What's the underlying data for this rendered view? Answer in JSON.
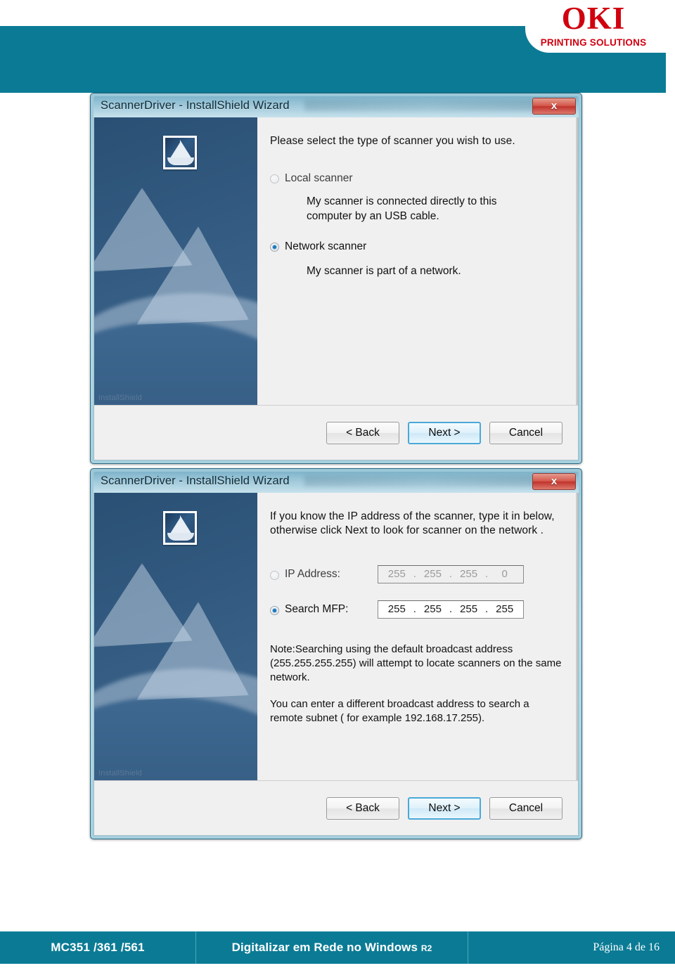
{
  "header": {
    "logo_word": "OKI",
    "logo_tagline": "PRINTING SOLUTIONS",
    "brand_color": "#d1000f",
    "band_color": "#0b7b95"
  },
  "dialog1": {
    "title": "ScannerDriver - InstallShield Wizard",
    "close_label": "x",
    "side_panel_text": "InstallShield",
    "prompt": "Please select the type of scanner you wish to use.",
    "options": [
      {
        "label": "Local scanner",
        "selected": false,
        "description": "My scanner is connected directly to this computer by an USB cable."
      },
      {
        "label": "Network scanner",
        "selected": true,
        "description": "My scanner is part of a network."
      }
    ],
    "buttons": {
      "back": "< Back",
      "back_prefix": "< ",
      "back_accel": "B",
      "back_rest": "ack",
      "next": "Next >",
      "cancel": "Cancel"
    }
  },
  "dialog2": {
    "title": "ScannerDriver - InstallShield Wizard",
    "close_label": "x",
    "side_panel_text": "InstallShield",
    "prompt": "If you know the IP address of the scanner, type it in below, otherwise click Next to look for scanner on the network .",
    "ip_address": {
      "label": "IP Address:",
      "selected": false,
      "enabled": false,
      "octets": [
        "255",
        "255",
        "255",
        "0"
      ]
    },
    "search_mfp": {
      "label": "Search MFP:",
      "selected": true,
      "enabled": true,
      "octets": [
        "255",
        "255",
        "255",
        "255"
      ]
    },
    "note1": "Note:Searching using the default broadcast address (255.255.255.255) will attempt to locate scanners on the same network.",
    "note2": "You can enter a different broadcast address to search a remote subnet ( for example 192.168.17.255).",
    "buttons": {
      "back": "< Back",
      "next": "Next >",
      "cancel": "Cancel"
    }
  },
  "footer": {
    "model": "MC351 /361 /561",
    "doc_title": "Digitalizar em Rede no Windows",
    "doc_revision": "R2",
    "page_info": "Página 4 de 16"
  }
}
